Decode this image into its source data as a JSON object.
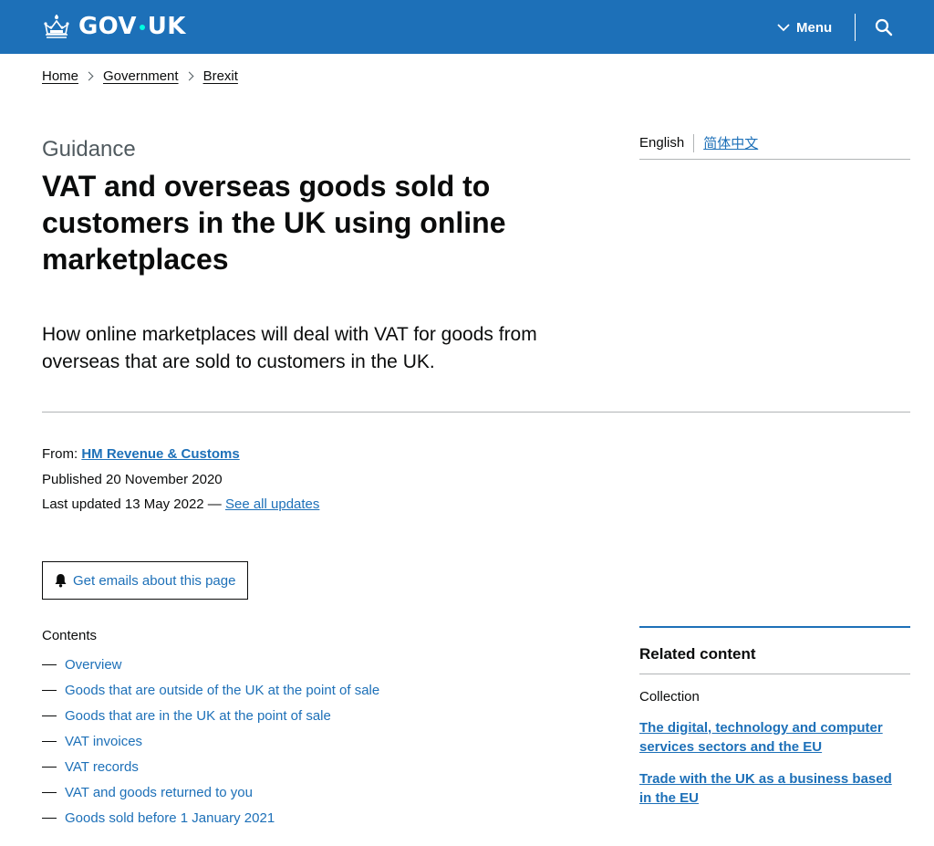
{
  "header": {
    "logo_text_left": "GOV",
    "logo_text_right": "UK",
    "menu_label": "Menu",
    "icons": {
      "crown": "crown-icon",
      "menu_chevron": "chevron-down-icon",
      "search": "search-icon"
    },
    "colors": {
      "brand_blue": "#1d70b8",
      "logo_dot": "#00ffe0"
    }
  },
  "breadcrumb": [
    "Home",
    "Government",
    "Brexit"
  ],
  "page": {
    "caption": "Guidance",
    "title": "VAT and overseas goods sold to customers in the UK using online marketplaces",
    "lede": "How online marketplaces will deal with VAT for goods from overseas that are sold to customers in the UK."
  },
  "languages": {
    "current": "English",
    "alternate": "简体中文"
  },
  "metadata": {
    "from_label": "From:",
    "organisation": "HM Revenue & Customs",
    "published": "Published 20 November 2020",
    "last_updated": "Last updated 13 May 2022 —",
    "see_updates": "See all updates"
  },
  "email_button": {
    "label": "Get emails about this page",
    "icon": "bell-icon"
  },
  "contents": {
    "title": "Contents",
    "items": [
      "Overview",
      "Goods that are outside of the UK at the point of sale",
      "Goods that are in the UK at the point of sale",
      "VAT invoices",
      "VAT records",
      "VAT and goods returned to you",
      "Goods sold before 1 January 2021"
    ]
  },
  "related": {
    "title": "Related content",
    "subtitle": "Collection",
    "links": [
      "The digital, technology and computer services sectors and the EU",
      "Trade with the UK as a business based in the EU"
    ]
  }
}
